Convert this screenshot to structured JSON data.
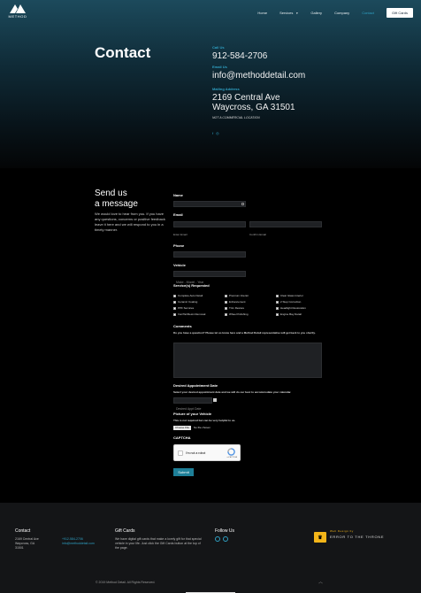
{
  "brand": {
    "name": "METHOD"
  },
  "nav": {
    "items": [
      {
        "label": "Home",
        "active": false
      },
      {
        "label": "Services",
        "active": false,
        "has_dropdown": true
      },
      {
        "label": "Gallery",
        "active": false
      },
      {
        "label": "Company",
        "active": false
      },
      {
        "label": "Contact",
        "active": true
      }
    ],
    "cta": "Gift Cards"
  },
  "hero": {
    "title": "Contact",
    "call_label": "Call Us",
    "phone": "912-584-2706",
    "email_label": "Email Us",
    "email": "info@methoddetail.com",
    "address_label": "Mailing Address",
    "address_line1": "2169 Central Ave",
    "address_line2": "Waycross, GA 31501",
    "address_note": "NOT A COMMERCIAL LOCATION",
    "social": [
      "facebook-icon",
      "instagram-icon"
    ]
  },
  "intro": {
    "title_line1": "Send us",
    "title_line2": "a message",
    "text": "We would love to hear from you. If you have any questions, concerns or positive feedback leave it here and we will respond to you in a timely manner."
  },
  "form": {
    "name_label": "Name",
    "email_label": "Email",
    "email_sub": "Enter Email",
    "confirm_sub": "Confirm Email",
    "phone_label": "Phone",
    "vehicle_label": "Vehicle",
    "vehicle_placeholder": "Make - Model - Year",
    "services_label": "Service(s) Requested",
    "services": [
      "Complete Auto Detail",
      "Premium Interior",
      "Clear Glass Interior",
      "Ceramic Coating",
      "Enhancement",
      "2 Step Correction",
      "PPF Services",
      "Trim Restore",
      "Headlight Restoration",
      "Iron/Tar/Resin Removal",
      "Wheel Polishing",
      "Engine Bay Detail"
    ],
    "comments_label": "Comments",
    "comments_help": "Do you have a question? Please let us know here and a Method Detail representative will get back to you shortly.",
    "date_label": "Desired Appointment Date",
    "date_help": "Select your desired appointment date and we will do our best to accommodate your calendar.",
    "date_placeholder": "Desired Appt Date",
    "picture_label": "Picture of your Vehicle",
    "picture_help": "This is not required but can be very helpful to us.",
    "file_button": "Choose File",
    "file_status": "No file chosen",
    "captcha_label": "CAPTCHA",
    "captcha_text": "I'm not a robot",
    "captcha_sub": "reCAPTCHA",
    "submit": "Submit"
  },
  "footer": {
    "contact_title": "Contact",
    "addr1": "2169 Central Ave",
    "addr2": "Waycross, GA",
    "zip": "31501",
    "phone": "+912-584-2706",
    "email": "info@methoddetail.com",
    "gift_title": "Gift Cards",
    "gift_text": "We have digital gift cards that make a lovely gift for that special vehicle in your life. Just click the Gift Cards button at the top of the page.",
    "follow_title": "Follow Us",
    "credit_top": "Web Design by",
    "credit_name": "ERROR TO THE THRONE",
    "copyright": "© 2019 Method Detail. All Rights Reserved."
  },
  "colors": {
    "accent": "#2fa1c4",
    "submit": "#1e7f98",
    "credit": "#f4b519"
  }
}
